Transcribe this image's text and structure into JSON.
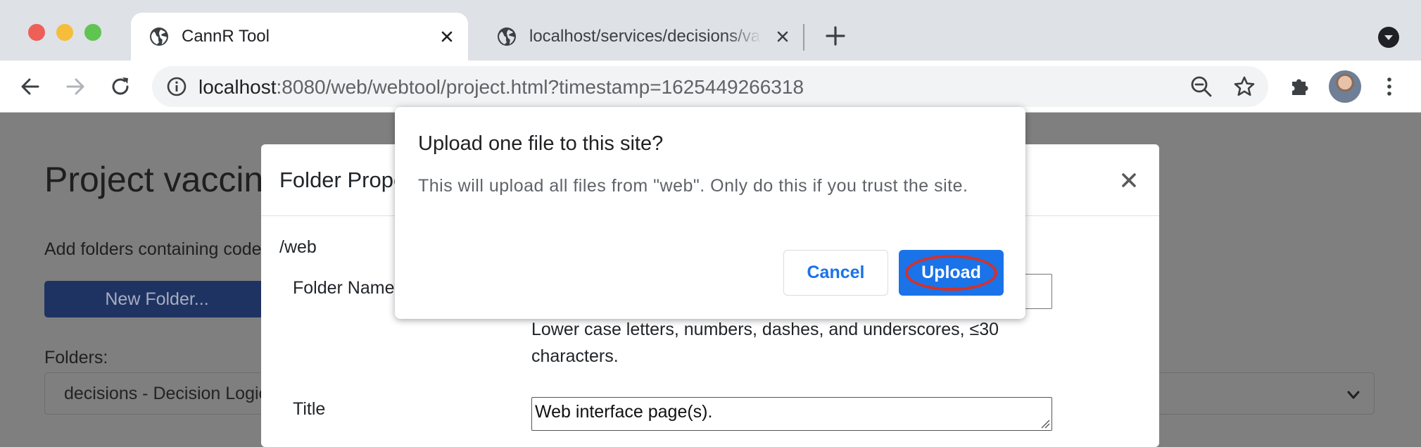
{
  "browser": {
    "tabs": [
      {
        "title": "CannR Tool",
        "active": true
      },
      {
        "title": "localhost/services/decisions/vaccine",
        "active": false
      }
    ],
    "url_host": "localhost",
    "url_rest": ":8080/web/webtool/project.html?timestamp=1625449266318"
  },
  "page": {
    "title": "Project vaccine",
    "intro": "Add folders containing code",
    "new_folder_button": "New Folder...",
    "folders_label": "Folders:",
    "folders_selected": "decisions - Decision Logic"
  },
  "modal": {
    "title": "Folder Properties",
    "path": "/web",
    "folder_name_label": "Folder Name",
    "folder_name_help": "Lower case letters, numbers, dashes, and underscores, ≤30 characters.",
    "title_label": "Title",
    "title_value": "Web interface page(s)."
  },
  "dialog": {
    "title": "Upload one file to this site?",
    "message": "This will upload all files from \"web\". Only do this if you trust the site.",
    "cancel": "Cancel",
    "upload": "Upload"
  },
  "colors": {
    "accent": "#1a73e8",
    "highlight_ring": "#d93025",
    "primary_button": "#1f3363"
  }
}
